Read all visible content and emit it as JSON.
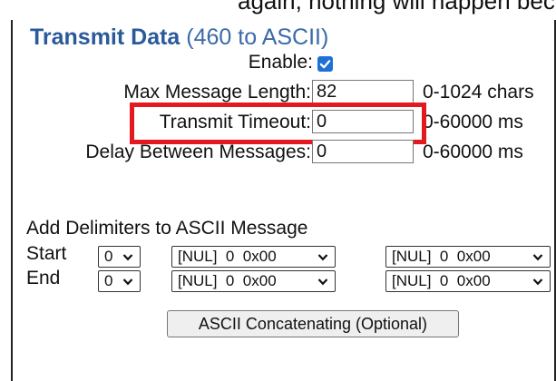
{
  "top_fragment": "again, nothing will happen because of the m PC",
  "section_title": "Transmit Data",
  "section_subtitle": "(460 to ASCII)",
  "enable": {
    "label": "Enable:",
    "checked": true,
    "icon": "checkmark-icon"
  },
  "fields": [
    {
      "label": "Max Message Length:",
      "value": "82",
      "range": "0-1024 chars"
    },
    {
      "label": "Transmit Timeout:",
      "value": "0",
      "range": "0-60000 ms"
    },
    {
      "label": "Delay Between Messages:",
      "value": "0",
      "range": "0-60000 ms"
    }
  ],
  "delimiters": {
    "heading": "Add Delimiters to ASCII Message",
    "rows": [
      {
        "label": "Start",
        "count": "0",
        "char1": "[NUL]  0  0x00",
        "char2": "[NUL]  0  0x00"
      },
      {
        "label": "End",
        "count": "0",
        "char1": "[NUL]  0  0x00",
        "char2": "[NUL]  0  0x00"
      }
    ]
  },
  "concat_button": "ASCII Concatenating (Optional)",
  "colors": {
    "title": "#2a5a9a",
    "highlight": "#e3191f",
    "checkbox": "#1f6fd6"
  }
}
